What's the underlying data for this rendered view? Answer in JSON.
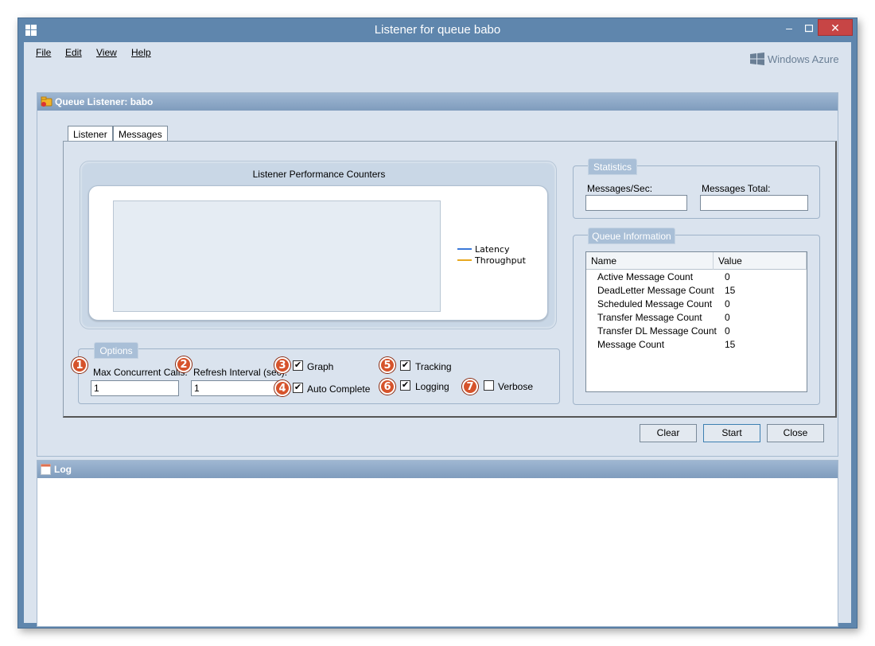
{
  "window": {
    "title": "Listener for queue babo",
    "minimize_glyph": "–",
    "maximize_glyph": "□",
    "close_glyph": "✕"
  },
  "menu": {
    "file": "File",
    "edit": "Edit",
    "view": "View",
    "help": "Help"
  },
  "brand": {
    "text": "Windows Azure"
  },
  "panel": {
    "title": "Queue Listener: babo"
  },
  "tabs": [
    {
      "label": "Listener",
      "active": true
    },
    {
      "label": "Messages",
      "active": false
    }
  ],
  "performance": {
    "title": "Listener Performance Counters",
    "legend": [
      {
        "name": "Latency",
        "color": "#3b78d8"
      },
      {
        "name": "Throughput",
        "color": "#e8a820"
      }
    ]
  },
  "options": {
    "title": "Options",
    "max_concurrent_calls_label": "Max Concurrent Calls:",
    "max_concurrent_calls_value": "1",
    "refresh_interval_label": "Refresh Interval (sec):",
    "refresh_interval_value": "1",
    "graph_label": "Graph",
    "graph_checked": true,
    "auto_complete_label": "Auto Complete",
    "auto_complete_checked": true,
    "tracking_label": "Tracking",
    "tracking_checked": true,
    "logging_label": "Logging",
    "logging_checked": true,
    "verbose_label": "Verbose",
    "verbose_checked": false
  },
  "badges": [
    "1",
    "2",
    "3",
    "4",
    "5",
    "6",
    "7"
  ],
  "statistics": {
    "title": "Statistics",
    "messages_per_sec_label": "Messages/Sec:",
    "messages_per_sec_value": "",
    "messages_total_label": "Messages Total:",
    "messages_total_value": ""
  },
  "queue_info": {
    "title": "Queue Information",
    "columns": [
      "Name",
      "Value"
    ],
    "rows": [
      {
        "name": "Active Message Count",
        "value": "0"
      },
      {
        "name": "DeadLetter Message Count",
        "value": "15"
      },
      {
        "name": "Scheduled Message Count",
        "value": "0"
      },
      {
        "name": "Transfer Message Count",
        "value": "0"
      },
      {
        "name": "Transfer DL Message Count",
        "value": "0"
      },
      {
        "name": "Message Count",
        "value": "15"
      }
    ]
  },
  "buttons": {
    "clear": "Clear",
    "start": "Start",
    "close": "Close"
  },
  "log": {
    "title": "Log"
  },
  "colors": {
    "titlebar": "#5f86ad",
    "close": "#c74545",
    "badge": "#d6532b",
    "panel_header": "#8ea9c7"
  }
}
